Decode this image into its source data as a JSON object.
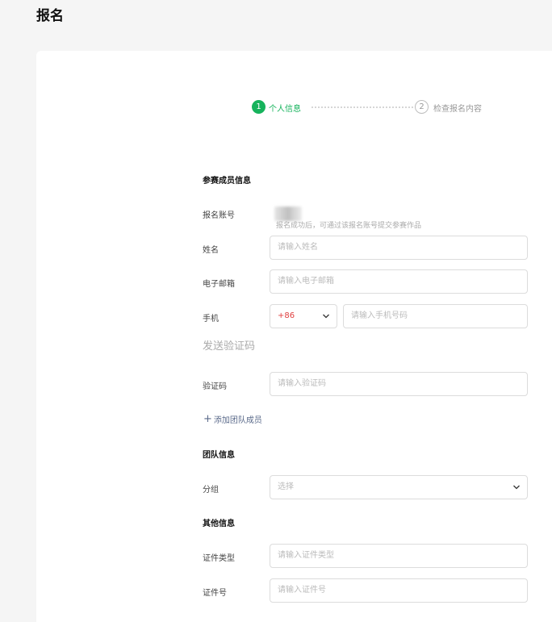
{
  "page": {
    "title": "报名"
  },
  "steps": [
    {
      "number": "1",
      "label": "个人信息",
      "state": "active"
    },
    {
      "number": "2",
      "label": "检查报名内容",
      "state": "inactive"
    }
  ],
  "colors": {
    "accent": "#16b35c",
    "link": "#5a6a8a"
  },
  "sections": {
    "members": "参赛成员信息",
    "team": "团队信息",
    "other": "其他信息"
  },
  "fields": {
    "account": {
      "label": "报名账号",
      "hint": "报名成功后，可通过该报名账号提交参赛作品"
    },
    "name": {
      "label": "姓名",
      "placeholder": "请输入姓名"
    },
    "email": {
      "label": "电子邮箱",
      "placeholder": "请输入电子邮箱"
    },
    "phone": {
      "label": "手机",
      "country_code": "+86",
      "placeholder": "请输入手机号码"
    },
    "send_code": "发送验证码",
    "code": {
      "label": "验证码",
      "placeholder": "请输入验证码"
    },
    "add_member": "添加团队成员",
    "group": {
      "label": "分组",
      "placeholder": "选择"
    },
    "id_type": {
      "label": "证件类型",
      "placeholder": "请输入证件类型"
    },
    "id_number": {
      "label": "证件号",
      "placeholder": "请输入证件号"
    }
  }
}
